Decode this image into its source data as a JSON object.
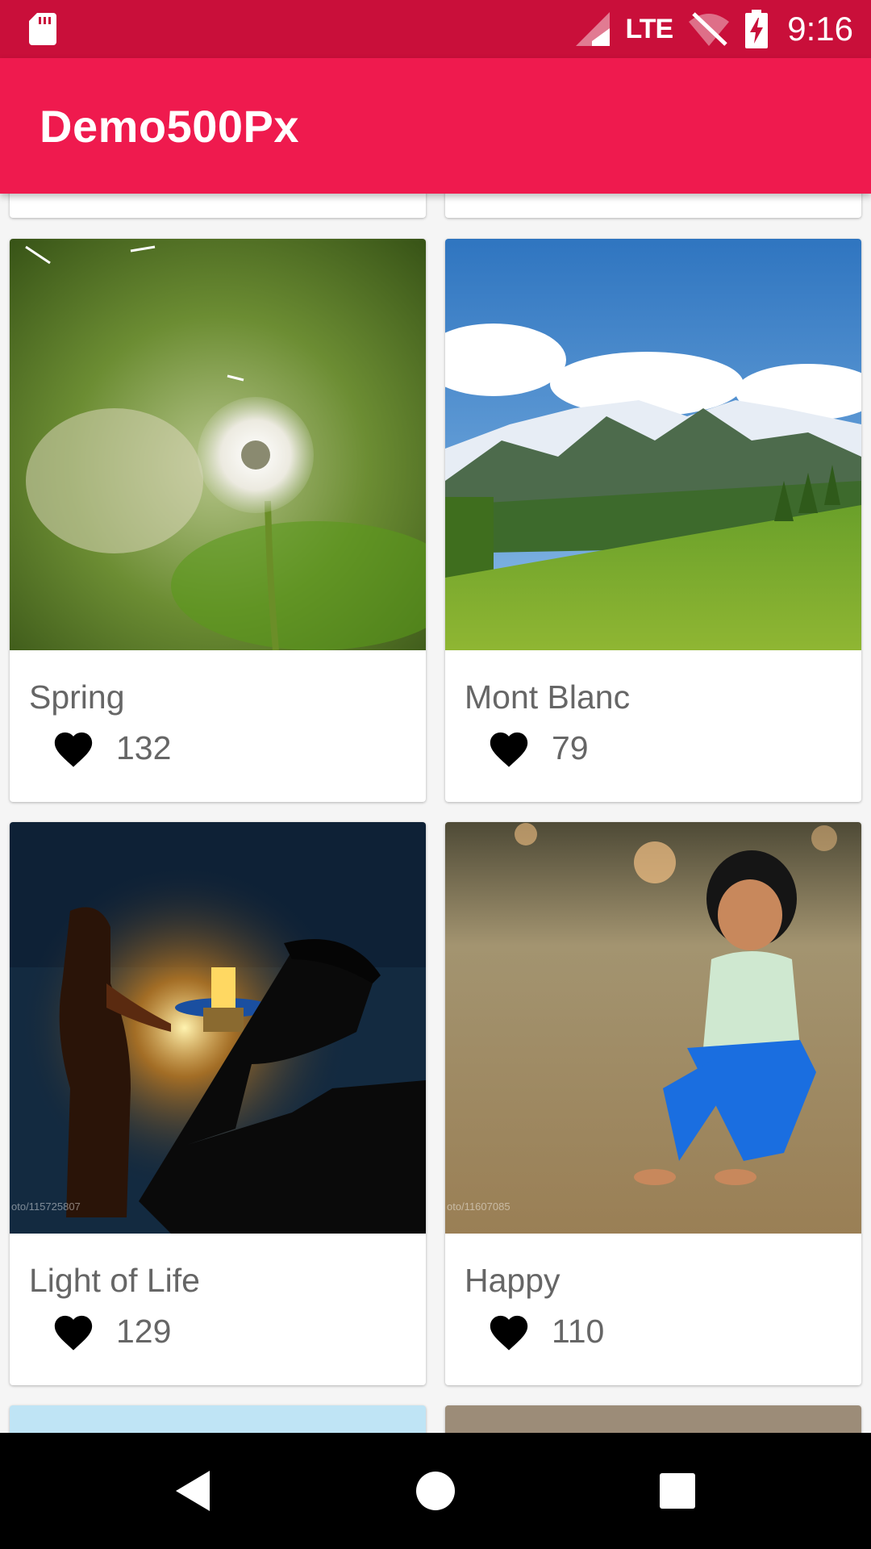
{
  "status_bar": {
    "network": "LTE",
    "time": "9:16"
  },
  "app_bar": {
    "title": "Demo500Px"
  },
  "photos": [
    {
      "title": "Spring",
      "likes": "132"
    },
    {
      "title": "Mont Blanc",
      "likes": "79"
    },
    {
      "title": "Light of Life",
      "likes": "129",
      "watermark": "oto/115725807"
    },
    {
      "title": "Happy",
      "likes": "110",
      "watermark": "oto/11607085"
    }
  ],
  "colors": {
    "status_bar": "#c90f3a",
    "app_bar": "#ef1a4e"
  },
  "icons": [
    "sd-card-icon",
    "signal-icon",
    "wifi-off-icon",
    "battery-charging-icon",
    "heart-icon",
    "back-icon",
    "home-icon",
    "recents-icon"
  ]
}
